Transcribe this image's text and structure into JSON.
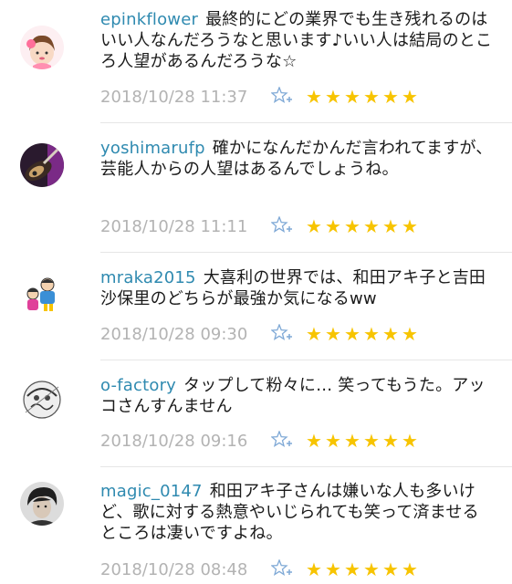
{
  "comments": [
    {
      "username": "epinkflower",
      "text": "最終的にどの業界でも生き残れるのはいい人なんだろうなと思います♪いい人は結局のところ人望があるんだろうな☆",
      "timestamp": "2018/10/28 11:37",
      "stars": "★★★★★★"
    },
    {
      "username": "yoshimarufp",
      "text": "確かになんだかんだ言われてますが、芸能人からの人望はあるんでしょうね。",
      "timestamp": "2018/10/28 11:11",
      "stars": "★★★★★★"
    },
    {
      "username": "mraka2015",
      "text": "大喜利の世界では、和田アキ子と吉田沙保里のどちらが最強か気になるww",
      "timestamp": "2018/10/28 09:30",
      "stars": "★★★★★★"
    },
    {
      "username": "o-factory",
      "text": "タップして粉々に… 笑ってもうた。アッコさんすんません",
      "timestamp": "2018/10/28 09:16",
      "stars": "★★★★★★"
    },
    {
      "username": "magic_0147",
      "text": "和田アキ子さんは嫌いな人も多いけど、歌に対する熱意やいじられても笑って済ませるところは凄いですよね。",
      "timestamp": "2018/10/28 08:48",
      "stars": "★★★★★★"
    }
  ],
  "colors": {
    "username": "#2f8ab0",
    "timestamp": "#b3b3b3",
    "star": "#f7c400",
    "fav_icon": "#7fa9d6"
  },
  "icons": {
    "favorite": "star-plus-icon",
    "rating": "star-icon"
  }
}
